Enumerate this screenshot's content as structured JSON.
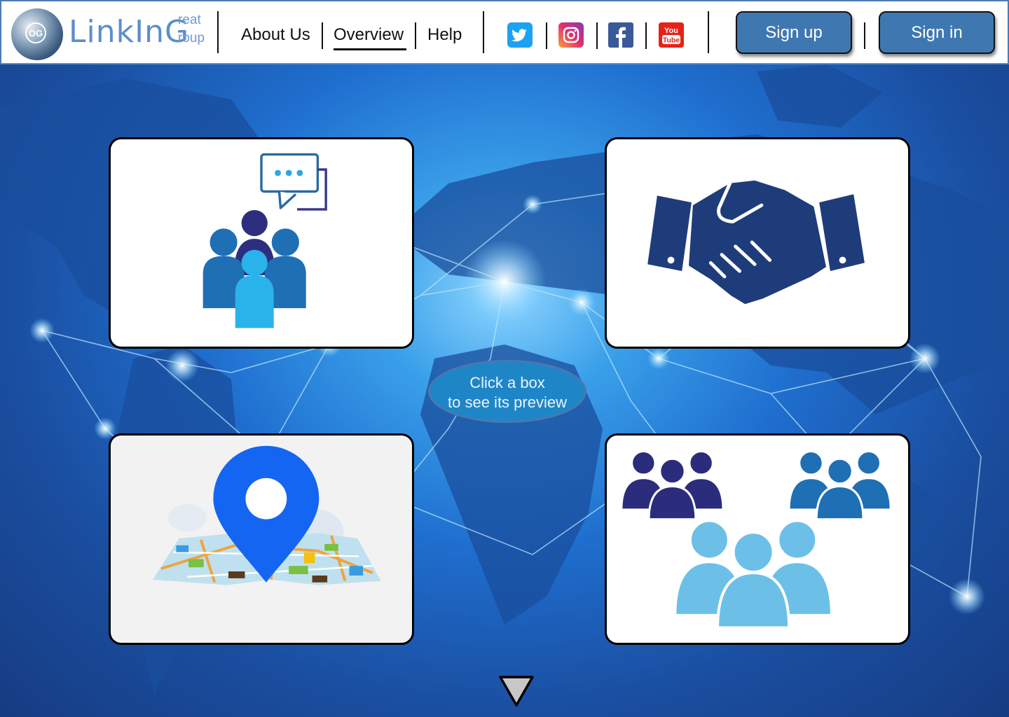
{
  "header": {
    "logo": {
      "word": "LinkInG",
      "sub_top": "reat",
      "sub_bottom": "roup",
      "badge": "OG"
    },
    "nav": [
      {
        "label": "About Us"
      },
      {
        "label": "Overview",
        "active": true
      },
      {
        "label": "Help"
      }
    ],
    "social": [
      {
        "icon": "twitter-icon",
        "color": "#1da1f2"
      },
      {
        "icon": "instagram-icon",
        "color": "#c13584"
      },
      {
        "icon": "facebook-icon",
        "color": "#3b5998"
      },
      {
        "icon": "youtube-icon",
        "color": "#e62117",
        "text_top": "You",
        "text_bottom": "Tube"
      }
    ],
    "signup_label": "Sign up",
    "signin_label": "Sign in"
  },
  "main": {
    "cards": [
      {
        "icon": "group-chat-icon"
      },
      {
        "icon": "handshake-icon"
      },
      {
        "icon": "map-location-icon"
      },
      {
        "icon": "teams-icon"
      }
    ],
    "hint_line1": "Click a box",
    "hint_line2": "to see its preview",
    "scroll_icon": "triangle-down-icon"
  },
  "colors": {
    "button": "#3f78b0",
    "hint_bubble": "#1e86c7",
    "navy": "#1f3c7a",
    "mid_blue": "#1f6fb5",
    "light_blue": "#6cc0e8"
  }
}
